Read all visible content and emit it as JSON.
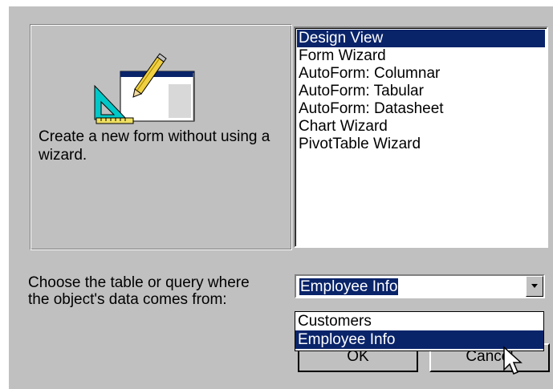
{
  "preview": {
    "description": "Create a new form without using a wizard.",
    "icon": "form-design-icon"
  },
  "form_types": {
    "items": [
      "Design View",
      "Form Wizard",
      "AutoForm:  Columnar",
      "AutoForm:  Tabular",
      "AutoForm:  Datasheet",
      "Chart Wizard",
      "PivotTable Wizard"
    ],
    "selected": "Design View"
  },
  "source": {
    "prompt_line1": "Choose the table or query where",
    "prompt_line2": "the object's data comes from:",
    "value": "Employee Info",
    "options": [
      "Customers",
      "Employee Info"
    ]
  },
  "buttons": {
    "ok": "OK",
    "cancel": "Cancel"
  },
  "colors": {
    "dialog_bg": "#c0c0c0",
    "selection": "#0a246a"
  }
}
